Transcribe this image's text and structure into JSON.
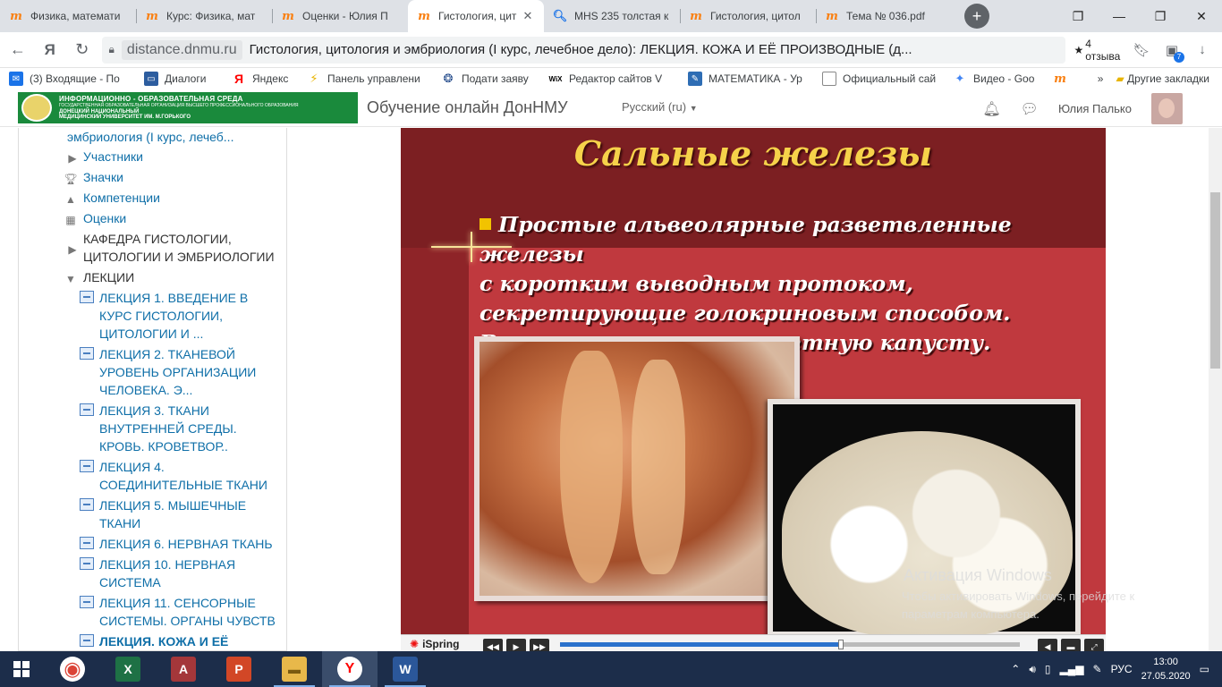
{
  "browser": {
    "tabs": [
      {
        "label": "Физика, математи",
        "favicon": "moodle-icon"
      },
      {
        "label": "Курс: Физика, мат",
        "favicon": "moodle-icon"
      },
      {
        "label": "Оценки - Юлия П",
        "favicon": "moodle-icon"
      },
      {
        "label": "Гистология, цит",
        "favicon": "moodle-icon",
        "active": true
      },
      {
        "label": "MHS 235 толстая к",
        "favicon": "search-icon"
      },
      {
        "label": "Гистология, цитол",
        "favicon": "moodle-icon"
      },
      {
        "label": "Тема № 036.pdf",
        "favicon": "moodle-icon"
      }
    ],
    "new_tab": "+",
    "address": {
      "domain": "distance.dnmu.ru",
      "page_title": "Гистология, цитология и эмбриология (I курс, лечебное дело): ЛЕКЦИЯ. КОЖА И ЕЁ ПРОИЗВОДНЫЕ (д...",
      "reviews": "4 отзыва",
      "notification_count": "7"
    },
    "bookmarks": [
      {
        "label": "(3) Входящие - По",
        "icon": "mail-icon",
        "color": "#1a73e8"
      },
      {
        "label": "Диалоги",
        "icon": "chat-icon",
        "color": "#2d5d9f"
      },
      {
        "label": "Яндекс",
        "icon": "yandex-icon",
        "color": "#ff0000"
      },
      {
        "label": "Панель управлени",
        "icon": "panel-icon",
        "color": "#e8b400"
      },
      {
        "label": "Подати заяву",
        "icon": "emblem-icon",
        "color": "#1c4587"
      },
      {
        "label": "Редактор сайтов V",
        "icon": "wix-icon",
        "color": "#000000"
      },
      {
        "label": "МАТЕМАТИКА - Ур",
        "icon": "pencil-icon",
        "color": "#2e6db4"
      },
      {
        "label": "Официальный сай",
        "icon": "page-icon",
        "color": "#888888"
      },
      {
        "label": "Видео - Goo",
        "icon": "google-icon",
        "color": "#4285f4"
      },
      {
        "label": "",
        "icon": "moodle-icon",
        "color": "#f98012"
      }
    ],
    "bookmarks_more": "»",
    "other_bookmarks": "Другие закладки"
  },
  "moodle": {
    "logo": {
      "line1": "ИНФОРМАЦИОННО - ОБРАЗОВАТЕЛЬНАЯ СРЕДА",
      "line2": "ГОСУДАРСТВЕННАЯ ОБРАЗОВАТЕЛЬНАЯ ОРГАНИЗАЦИЯ ВЫСШЕГО ПРОФЕССИОНАЛЬНОГО ОБРАЗОВАНИЯ",
      "line3": "ДОНЕЦКИЙ НАЦИОНАЛЬНЫЙ",
      "line4": "МЕДИЦИНСКИЙ УНИВЕРСИТЕТ ИМ. М.ГОРЬКОГО"
    },
    "site_name": "Обучение онлайн ДонНМУ",
    "language": "Русский (ru)",
    "user_name": "Юлия Палько"
  },
  "sidebar": {
    "course_tail": "эмбриология (I курс, лечеб...",
    "items": [
      {
        "label": "Участники",
        "icon": "caret-right-icon"
      },
      {
        "label": "Значки",
        "icon": "trophy-icon"
      },
      {
        "label": "Компетенции",
        "icon": "competency-icon"
      },
      {
        "label": "Оценки",
        "icon": "grades-table-icon"
      },
      {
        "label": "КАФЕДРА ГИСТОЛОГИИ, ЦИТОЛОГИИ И ЭМБРИОЛОГИИ",
        "icon": "caret-right-icon"
      },
      {
        "label": "ЛЕКЦИИ",
        "icon": "caret-down-icon"
      }
    ],
    "lectures": [
      {
        "label": "ЛЕКЦИЯ 1. ВВЕДЕНИЕ В КУРС ГИСТОЛОГИИ, ЦИТОЛОГИИ И ..."
      },
      {
        "label": "ЛЕКЦИЯ 2. ТКАНЕВОЙ УРОВЕНЬ ОРГАНИЗАЦИИ ЧЕЛОВЕКА. Э..."
      },
      {
        "label": "ЛЕКЦИЯ 3. ТКАНИ ВНУТРЕННЕЙ СРЕДЫ. КРОВЬ. КРОВЕТВОР.."
      },
      {
        "label": "ЛЕКЦИЯ 4. СОЕДИНИТЕЛЬНЫЕ ТКАНИ"
      },
      {
        "label": "ЛЕКЦИЯ 5. МЫШЕЧНЫЕ ТКАНИ"
      },
      {
        "label": "ЛЕКЦИЯ 6. НЕРВНАЯ ТКАНЬ"
      },
      {
        "label": "ЛЕКЦИЯ 10. НЕРВНАЯ СИСТЕМА"
      },
      {
        "label": "ЛЕКЦИЯ 11. СЕНСОРНЫЕ СИСТЕМЫ. ОРГАНЫ ЧУВСТВ"
      },
      {
        "label": "ЛЕКЦИЯ. КОЖА И ЕЁ",
        "current": true
      }
    ]
  },
  "slide": {
    "title": "Сальные железы",
    "text_lines": [
      "Простые альвеолярные разветвленные железы",
      "с коротким выводным протоком,",
      "секретирующие голокриновым способом.",
      "Внешне напоминают цветную капусту."
    ],
    "colors": {
      "title": "#f6d24a",
      "background": "#c0393e",
      "band": "#7c1f22"
    }
  },
  "watermark": {
    "line1": "Активация Windows",
    "line2": "Чтобы активировать Windows, перейдите к",
    "line3": "параметрам компьютера."
  },
  "player": {
    "brand": "iSpring",
    "progress": 0.61
  },
  "taskbar": {
    "apps": [
      {
        "name": "chrome-icon",
        "color": "#db4437",
        "glyph": "◉"
      },
      {
        "name": "excel-icon",
        "color": "#1e7145",
        "glyph": "X"
      },
      {
        "name": "access-icon",
        "color": "#a4373a",
        "glyph": "A"
      },
      {
        "name": "powerpoint-icon",
        "color": "#d24726",
        "glyph": "P"
      },
      {
        "name": "explorer-icon",
        "color": "#e8b84a",
        "glyph": "▬"
      },
      {
        "name": "yandex-browser-icon",
        "color": "#e8e8e8",
        "glyph": "Y"
      },
      {
        "name": "word-icon",
        "color": "#2b579a",
        "glyph": "W"
      }
    ],
    "language": "РУС",
    "time": "13:00",
    "date": "27.05.2020"
  }
}
